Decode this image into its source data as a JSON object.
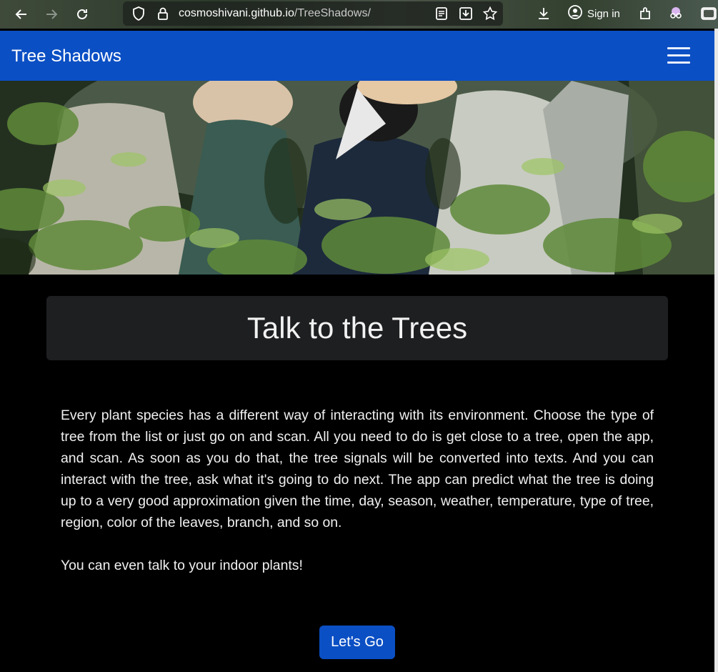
{
  "browser": {
    "url_host": "cosmoshivani.github.io",
    "url_path": "/TreeShadows/",
    "sign_in_label": "Sign in",
    "icons": [
      "back-arrow-icon",
      "forward-arrow-icon",
      "reload-icon",
      "shield-icon",
      "lock-icon",
      "reader-view-icon",
      "save-page-icon",
      "bookmark-star-icon",
      "downloads-icon",
      "account-icon",
      "extensions-icon",
      "mask-icon",
      "window-icon"
    ]
  },
  "navbar": {
    "brand": "Tree Shadows",
    "toggler_icon": "hamburger-menu-icon",
    "bg_color": "#0b4fc4"
  },
  "hero": {
    "description": "forest photo with people in hats among trees"
  },
  "main": {
    "heading": "Talk to the Trees",
    "paragraph": "Every plant species has a different way of interacting with its environment. Choose the type of tree from the list or just go on and scan. All you need to do is get close to a tree, open the app, and scan. As soon as you do that, the tree signals will be converted into texts. And you can interact with the tree, ask what it's going to do next. The app can predict what the tree is doing up to a very good approximation given the time, day, season, weather, temperature, type of tree, region, color of the leaves, branch, and so on.",
    "paragraph2": "You can even talk to your indoor plants!",
    "cta_label": "Let's Go"
  }
}
